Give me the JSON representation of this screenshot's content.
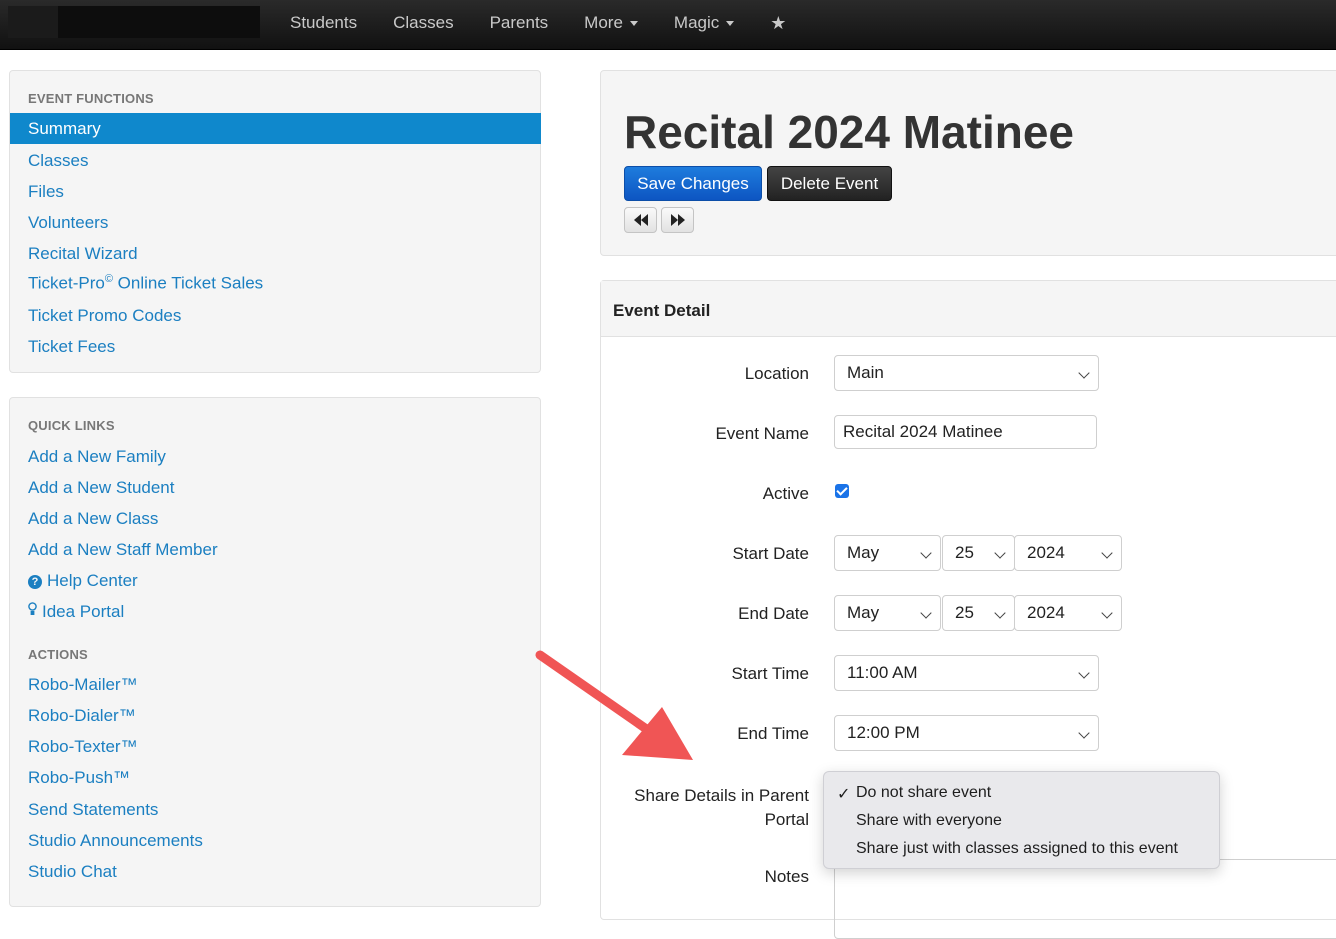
{
  "nav": {
    "items": [
      "Students",
      "Classes",
      "Parents",
      "More",
      "Magic"
    ],
    "dropdown_items": [
      "More",
      "Magic"
    ],
    "star_icon": "star-icon"
  },
  "sidebar": {
    "event_functions_header": "EVENT FUNCTIONS",
    "event_functions": [
      "Summary",
      "Classes",
      "Files",
      "Volunteers",
      "Recital Wizard",
      "Ticket-Pro",
      "Ticket Promo Codes",
      "Ticket Fees"
    ],
    "ticket_pro": {
      "name": "Ticket-Pro",
      "mark": "©",
      "suffix": " Online Ticket Sales"
    },
    "active_item": "Summary",
    "quick_links_header": "QUICK LINKS",
    "quick_links": [
      "Add a New Family",
      "Add a New Student",
      "Add a New Class",
      "Add a New Staff Member",
      "Help Center",
      "Idea Portal"
    ],
    "actions_header": "ACTIONS",
    "actions": [
      "Robo-Mailer™",
      "Robo-Dialer™",
      "Robo-Texter™",
      "Robo-Push™",
      "Send Statements",
      "Studio Announcements",
      "Studio Chat"
    ]
  },
  "event": {
    "title": "Recital 2024 Matinee",
    "save_label": "Save Changes",
    "delete_label": "Delete Event",
    "prev_icon": "rewind-icon",
    "next_icon": "fast-forward-icon"
  },
  "detail": {
    "header": "Event Detail",
    "location_label": "Location",
    "location_value": "Main",
    "event_name_label": "Event Name",
    "event_name_value": "Recital 2024 Matinee",
    "active_label": "Active",
    "active_checked": true,
    "start_date_label": "Start Date",
    "start_date": {
      "month": "May",
      "day": "25",
      "year": "2024"
    },
    "end_date_label": "End Date",
    "end_date": {
      "month": "May",
      "day": "25",
      "year": "2024"
    },
    "start_time_label": "Start Time",
    "start_time_value": "11:00 AM",
    "end_time_label": "End Time",
    "end_time_value": "12:00 PM",
    "share_label_line1": "Share Details in Parent",
    "share_label_line2": "Portal",
    "notes_label": "Notes"
  },
  "share_menu": {
    "options": [
      "Do not share event",
      "Share with everyone",
      "Share just with classes assigned to this event"
    ],
    "selected": "Do not share event",
    "check_mark": "✓"
  },
  "colors": {
    "nav_bg": "#1a1a1a",
    "link": "#1b7fc1",
    "active_bg": "#0f88cc",
    "save_button": "#1565d0",
    "delete_button": "#2b2b2b",
    "arrow": "#f05555"
  }
}
